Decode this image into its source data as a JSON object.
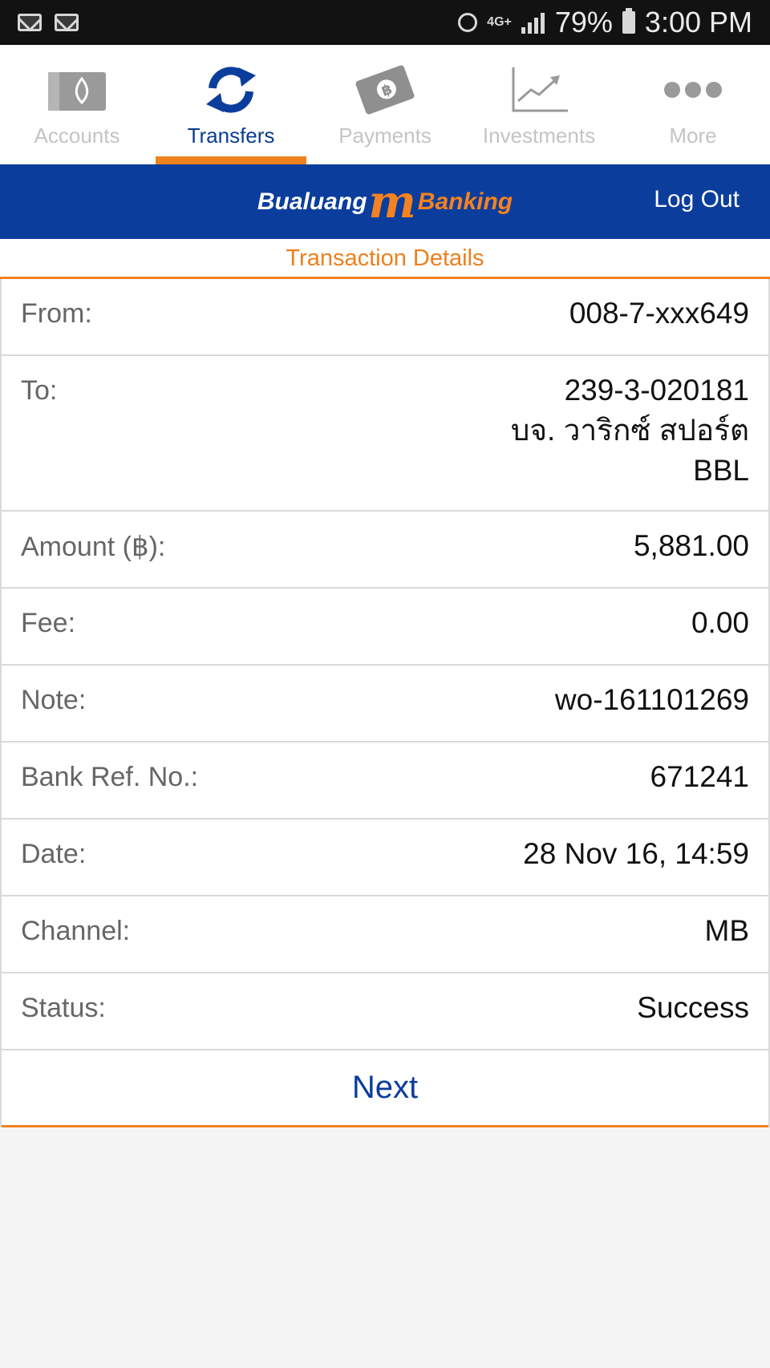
{
  "status_bar": {
    "battery": "79%",
    "time": "3:00 PM",
    "network": "4G+"
  },
  "tabs": [
    {
      "label": "Accounts",
      "icon": "wallet-icon",
      "active": false
    },
    {
      "label": "Transfers",
      "icon": "transfer-arrows-icon",
      "active": true
    },
    {
      "label": "Payments",
      "icon": "baht-card-icon",
      "active": false
    },
    {
      "label": "Investments",
      "icon": "line-chart-icon",
      "active": false
    },
    {
      "label": "More",
      "icon": "more-dots-icon",
      "active": false
    }
  ],
  "header": {
    "logo_part1": "Bualuang",
    "logo_part2": "m",
    "logo_part3": "Banking",
    "logout_label": "Log Out"
  },
  "section_title": "Transaction Details",
  "details": {
    "from": {
      "label": "From:",
      "value": "008-7-xxx649"
    },
    "to": {
      "label": "To:",
      "account": "239-3-020181",
      "name": "บจ. วาริกซ์ สปอร์ต",
      "bank": "BBL"
    },
    "amount": {
      "label": "Amount (฿):",
      "value": "5,881.00"
    },
    "fee": {
      "label": "Fee:",
      "value": "0.00"
    },
    "note": {
      "label": "Note:",
      "value": "wo-161101269"
    },
    "bank_ref": {
      "label": "Bank Ref. No.:",
      "value": "671241"
    },
    "date": {
      "label": "Date:",
      "value": "28 Nov 16, 14:59"
    },
    "channel": {
      "label": "Channel:",
      "value": "MB"
    },
    "status": {
      "label": "Status:",
      "value": "Success"
    }
  },
  "next_label": "Next",
  "colors": {
    "brand_blue": "#0b3d9c",
    "accent_orange": "#f0821e"
  }
}
